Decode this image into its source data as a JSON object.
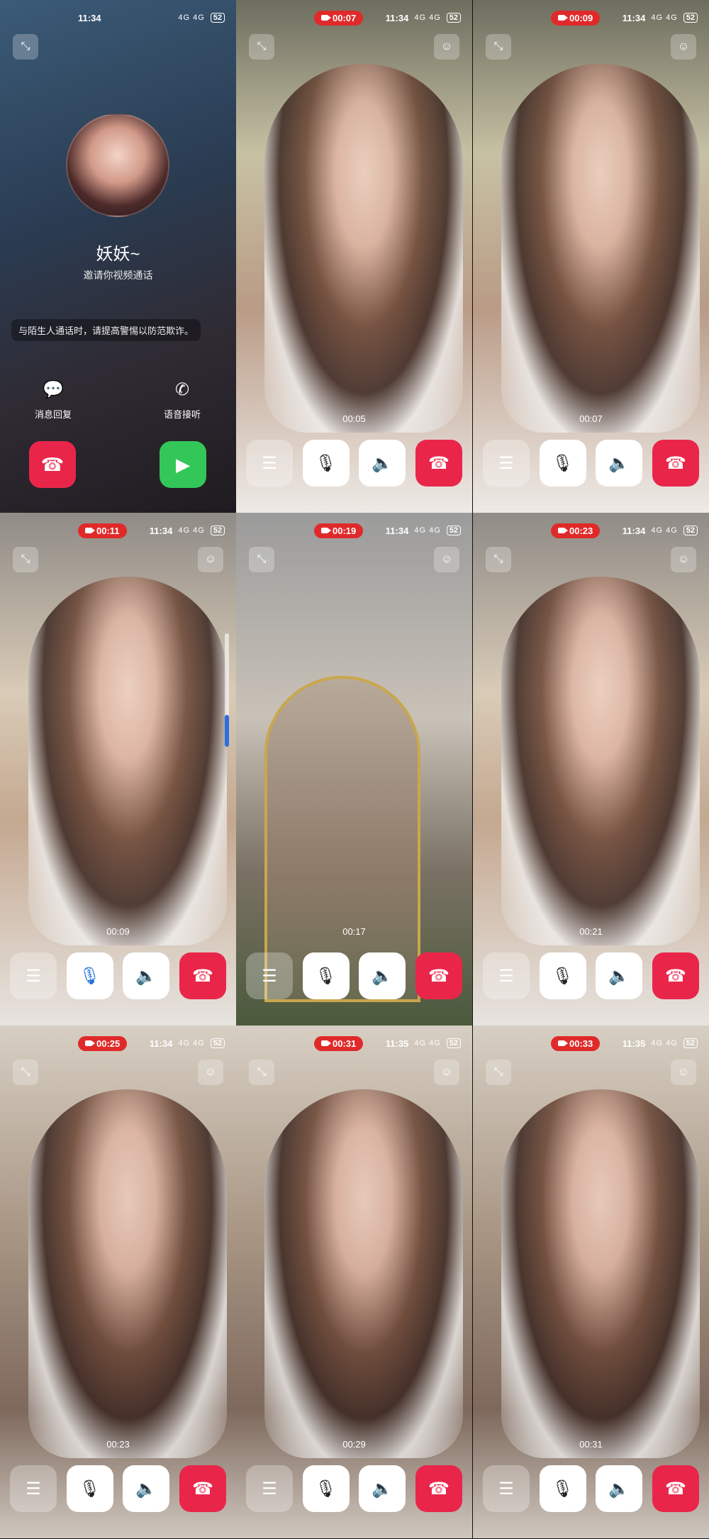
{
  "incoming": {
    "time": "11:34",
    "battery": "52",
    "signal": "4G 4G",
    "caller_name": "妖妖~",
    "subtitle": "邀请你视频通话",
    "warning": "与陌生人通话时，请提高警惕以防范欺诈。",
    "reply_label": "消息回复",
    "voice_answer_label": "语音接听"
  },
  "panels": [
    {
      "rec": "00:07",
      "time": "11:34",
      "battery": "52",
      "timer": "00:05"
    },
    {
      "rec": "00:09",
      "time": "11:34",
      "battery": "52",
      "timer": "00:07"
    },
    {
      "rec": "00:11",
      "time": "11:34",
      "battery": "52",
      "timer": "00:09"
    },
    {
      "rec": "00:19",
      "time": "11:34",
      "battery": "52",
      "timer": "00:17"
    },
    {
      "rec": "00:23",
      "time": "11:34",
      "battery": "52",
      "timer": "00:21"
    },
    {
      "rec": "00:25",
      "time": "11:34",
      "battery": "52",
      "timer": "00:23"
    },
    {
      "rec": "00:31",
      "time": "11:35",
      "battery": "52",
      "timer": "00:29"
    },
    {
      "rec": "00:33",
      "time": "11:35",
      "battery": "52",
      "timer": "00:31"
    }
  ],
  "icons": {
    "collapse": "⤡",
    "beauty": "☺",
    "menu": "☰",
    "mic": "🎙",
    "speaker": "🔈",
    "end": "☎",
    "video": "▶",
    "message": "💬",
    "phone": "✆"
  },
  "colors": {
    "end_call": "#e9264a",
    "accept": "#33c759",
    "rec_badge": "#e02a2a",
    "mic_active": "#1f6fd9"
  }
}
